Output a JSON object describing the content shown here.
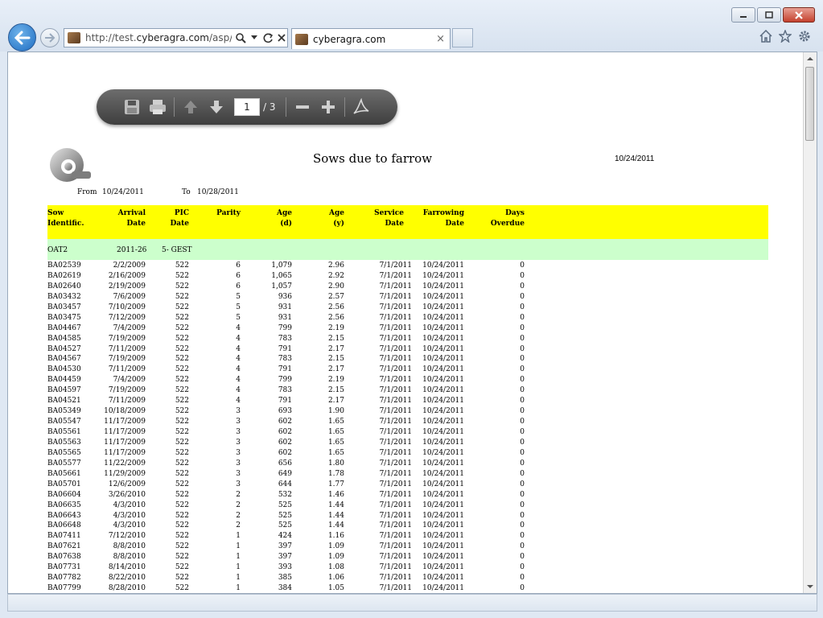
{
  "browser": {
    "url_prefix": "http://test.",
    "url_domain": "cyberagra.com",
    "url_suffix": "/asp/sys/",
    "tab_title": "cyberagra.com",
    "tab_close": "×",
    "icons": [
      "back-icon",
      "forward-icon",
      "search-icon",
      "dropdown-icon",
      "refresh-icon",
      "stop-icon",
      "home-icon",
      "favorites-star-icon",
      "gear-icon"
    ]
  },
  "pdf_toolbar": {
    "page_current": "1",
    "page_total": "/ 3",
    "icons": [
      "save-icon",
      "print-icon",
      "page-up-icon",
      "page-down-icon",
      "zoom-out-icon",
      "zoom-in-icon",
      "acrobat-icon"
    ]
  },
  "report": {
    "title": "Sows due to farrow",
    "date": "10/24/2011",
    "from_label": "From",
    "from_date": "10/24/2011",
    "to_label": "To",
    "to_date": "10/28/2011",
    "columns": [
      {
        "line1": "Sow",
        "line2": "Identific."
      },
      {
        "line1": "Arrival",
        "line2": "Date"
      },
      {
        "line1": "PIC",
        "line2": "Date"
      },
      {
        "line1": "Parity",
        "line2": ""
      },
      {
        "line1": "Age",
        "line2": "(d)"
      },
      {
        "line1": "Age",
        "line2": "(y)"
      },
      {
        "line1": "Service",
        "line2": "Date"
      },
      {
        "line1": "Farrowing",
        "line2": "Date"
      },
      {
        "line1": "Days",
        "line2": "Overdue"
      }
    ],
    "group": {
      "name": "OAT2",
      "code": "2011-26",
      "status": "5- GEST"
    },
    "rows": [
      [
        "BA02539",
        "2/2/2009",
        "522",
        "6",
        "1,079",
        "2.96",
        "7/1/2011",
        "10/24/2011",
        "0"
      ],
      [
        "BA02619",
        "2/16/2009",
        "522",
        "6",
        "1,065",
        "2.92",
        "7/1/2011",
        "10/24/2011",
        "0"
      ],
      [
        "BA02640",
        "2/19/2009",
        "522",
        "6",
        "1,057",
        "2.90",
        "7/1/2011",
        "10/24/2011",
        "0"
      ],
      [
        "BA03432",
        "7/6/2009",
        "522",
        "5",
        "936",
        "2.57",
        "7/1/2011",
        "10/24/2011",
        "0"
      ],
      [
        "BA03457",
        "7/10/2009",
        "522",
        "5",
        "931",
        "2.56",
        "7/1/2011",
        "10/24/2011",
        "0"
      ],
      [
        "BA03475",
        "7/12/2009",
        "522",
        "5",
        "931",
        "2.56",
        "7/1/2011",
        "10/24/2011",
        "0"
      ],
      [
        "BA04467",
        "7/4/2009",
        "522",
        "4",
        "799",
        "2.19",
        "7/1/2011",
        "10/24/2011",
        "0"
      ],
      [
        "BA04585",
        "7/19/2009",
        "522",
        "4",
        "783",
        "2.15",
        "7/1/2011",
        "10/24/2011",
        "0"
      ],
      [
        "BA04527",
        "7/11/2009",
        "522",
        "4",
        "791",
        "2.17",
        "7/1/2011",
        "10/24/2011",
        "0"
      ],
      [
        "BA04567",
        "7/19/2009",
        "522",
        "4",
        "783",
        "2.15",
        "7/1/2011",
        "10/24/2011",
        "0"
      ],
      [
        "BA04530",
        "7/11/2009",
        "522",
        "4",
        "791",
        "2.17",
        "7/1/2011",
        "10/24/2011",
        "0"
      ],
      [
        "BA04459",
        "7/4/2009",
        "522",
        "4",
        "799",
        "2.19",
        "7/1/2011",
        "10/24/2011",
        "0"
      ],
      [
        "BA04597",
        "7/19/2009",
        "522",
        "4",
        "783",
        "2.15",
        "7/1/2011",
        "10/24/2011",
        "0"
      ],
      [
        "BA04521",
        "7/11/2009",
        "522",
        "4",
        "791",
        "2.17",
        "7/1/2011",
        "10/24/2011",
        "0"
      ],
      [
        "BA05349",
        "10/18/2009",
        "522",
        "3",
        "693",
        "1.90",
        "7/1/2011",
        "10/24/2011",
        "0"
      ],
      [
        "BA05547",
        "11/17/2009",
        "522",
        "3",
        "602",
        "1.65",
        "7/1/2011",
        "10/24/2011",
        "0"
      ],
      [
        "BA05561",
        "11/17/2009",
        "522",
        "3",
        "602",
        "1.65",
        "7/1/2011",
        "10/24/2011",
        "0"
      ],
      [
        "BA05563",
        "11/17/2009",
        "522",
        "3",
        "602",
        "1.65",
        "7/1/2011",
        "10/24/2011",
        "0"
      ],
      [
        "BA05565",
        "11/17/2009",
        "522",
        "3",
        "602",
        "1.65",
        "7/1/2011",
        "10/24/2011",
        "0"
      ],
      [
        "BA05577",
        "11/22/2009",
        "522",
        "3",
        "656",
        "1.80",
        "7/1/2011",
        "10/24/2011",
        "0"
      ],
      [
        "BA05661",
        "11/29/2009",
        "522",
        "3",
        "649",
        "1.78",
        "7/1/2011",
        "10/24/2011",
        "0"
      ],
      [
        "BA05701",
        "12/6/2009",
        "522",
        "3",
        "644",
        "1.77",
        "7/1/2011",
        "10/24/2011",
        "0"
      ],
      [
        "BA06604",
        "3/26/2010",
        "522",
        "2",
        "532",
        "1.46",
        "7/1/2011",
        "10/24/2011",
        "0"
      ],
      [
        "BA06635",
        "4/3/2010",
        "522",
        "2",
        "525",
        "1.44",
        "7/1/2011",
        "10/24/2011",
        "0"
      ],
      [
        "BA06643",
        "4/3/2010",
        "522",
        "2",
        "525",
        "1.44",
        "7/1/2011",
        "10/24/2011",
        "0"
      ],
      [
        "BA06648",
        "4/3/2010",
        "522",
        "2",
        "525",
        "1.44",
        "7/1/2011",
        "10/24/2011",
        "0"
      ],
      [
        "BA07411",
        "7/12/2010",
        "522",
        "1",
        "424",
        "1.16",
        "7/1/2011",
        "10/24/2011",
        "0"
      ],
      [
        "BA07621",
        "8/8/2010",
        "522",
        "1",
        "397",
        "1.09",
        "7/1/2011",
        "10/24/2011",
        "0"
      ],
      [
        "BA07638",
        "8/8/2010",
        "522",
        "1",
        "397",
        "1.09",
        "7/1/2011",
        "10/24/2011",
        "0"
      ],
      [
        "BA07731",
        "8/14/2010",
        "522",
        "1",
        "393",
        "1.08",
        "7/1/2011",
        "10/24/2011",
        "0"
      ],
      [
        "BA07782",
        "8/22/2010",
        "522",
        "1",
        "385",
        "1.06",
        "7/1/2011",
        "10/24/2011",
        "0"
      ],
      [
        "BA07799",
        "8/28/2010",
        "522",
        "1",
        "384",
        "1.05",
        "7/1/2011",
        "10/24/2011",
        "0"
      ]
    ]
  }
}
